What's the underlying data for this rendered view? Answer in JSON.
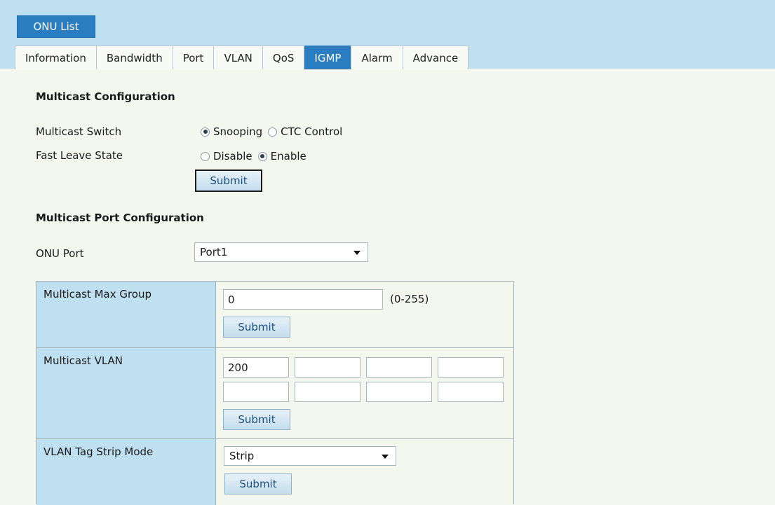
{
  "header": {
    "onu_list_label": "ONU List",
    "tabs": [
      {
        "label": "Information"
      },
      {
        "label": "Bandwidth"
      },
      {
        "label": "Port"
      },
      {
        "label": "VLAN"
      },
      {
        "label": "QoS"
      },
      {
        "label": "IGMP",
        "active": true
      },
      {
        "label": "Alarm"
      },
      {
        "label": "Advance"
      }
    ]
  },
  "multicast_config": {
    "title": "Multicast Configuration",
    "switch_label": "Multicast Switch",
    "switch_options": [
      {
        "label": "Snooping",
        "checked": true
      },
      {
        "label": "CTC Control",
        "checked": false
      }
    ],
    "fast_leave_label": "Fast Leave State",
    "fast_leave_options": [
      {
        "label": "Disable",
        "checked": false
      },
      {
        "label": "Enable",
        "checked": true
      }
    ],
    "submit_label": "Submit"
  },
  "port_config": {
    "title": "Multicast Port Configuration",
    "onu_port_label": "ONU Port",
    "onu_port_value": "Port1",
    "max_group": {
      "label": "Multicast Max Group",
      "value": "0",
      "range_hint": "(0-255)",
      "submit_label": "Submit"
    },
    "vlan": {
      "label": "Multicast VLAN",
      "values": [
        "200",
        "",
        "",
        "",
        "",
        "",
        "",
        ""
      ],
      "submit_label": "Submit"
    },
    "strip_mode": {
      "label": "VLAN Tag Strip Mode",
      "value": "Strip",
      "submit_label": "Submit"
    }
  },
  "colors": {
    "accent": "#2a7dc0",
    "header_bg": "#bfe0f1",
    "page_bg": "#f3f7ee"
  }
}
